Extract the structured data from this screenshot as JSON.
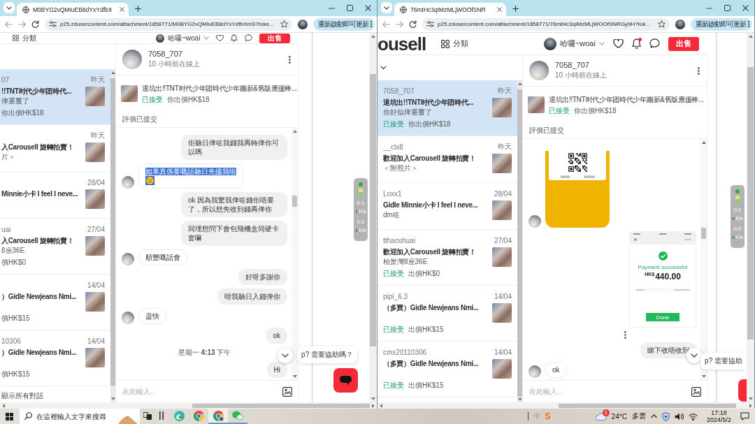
{
  "windows": [
    {
      "scrolled": true,
      "tab": {
        "title": "M0BYG2vQMIuEB8dYxYdfbX"
      },
      "toolbar": {
        "url": "p25.zdusercontent.com/attachment/1858771/M0BYG2vQMIuEB8dYxYdfbXmS?toke...",
        "update_label": "重新啟動即可更新"
      },
      "nav": {
        "categories": "分類",
        "greeting": "哈囉~woai",
        "sell": "出售",
        "bell_badge": false
      },
      "conversation_list": {
        "items": [
          {
            "name": "07",
            "date": "昨天",
            "title": "!!TNT时代少年团時代...",
            "preview": "俾重覆了",
            "offer": "你出價HK$18",
            "selected": true
          },
          {
            "date": "昨天",
            "title": "入Carousell 旋轉拍賣！",
            "preview": "片＞",
            "selected": false
          },
          {
            "date": "28/04",
            "title": "Minnie小卡 I feel I neve...",
            "selected": false
          },
          {
            "name": "uai",
            "date": "27/04",
            "title": "入Carousell 旋轉拍賣！",
            "preview": "8座36E",
            "offer": "價HK$0",
            "selected": false
          },
          {
            "date": "14/04",
            "title": "）Gidle Newjeans Nmi...",
            "offer": "價HK$15",
            "selected": false
          },
          {
            "name": "10306",
            "date": "14/04",
            "title": "）Gidle Newjeans Nmi...",
            "offer": "價HK$15",
            "selected": false
          }
        ],
        "footer": "顯示所有對話"
      },
      "chat": {
        "user": "7058_707",
        "status": "10 小時前在線上",
        "listing": {
          "title": "退坑出!!TNT时代少年团時代少年團新&舊版應援棒...",
          "state": "已接受",
          "offer": "你出價HK$18"
        },
        "notice": "評價已提交",
        "messages": [
          {
            "kind": "text",
            "outgoing": true,
            "text": "佢聽日俾咗我錢我再轉俾你可以嗎",
            "emoji": false,
            "highlighted": false
          },
          {
            "kind": "text",
            "outgoing": false,
            "text": "如果真係要嘅話聽日先搵我啦",
            "emoji": true,
            "highlighted": true
          },
          {
            "kind": "text",
            "outgoing": true,
            "text": "ok 因為我驚我俾咗錢佢唔要了，所以想先收到錢再俾你",
            "emoji": false,
            "highlighted": false
          },
          {
            "kind": "text",
            "outgoing": true,
            "text": "同埋想問下會包飛機盒同硬卡套嘛",
            "emoji": false,
            "highlighted": false
          },
          {
            "kind": "text",
            "outgoing": false,
            "text": "順豐嘅話會",
            "emoji": false,
            "highlighted": false
          },
          {
            "kind": "text",
            "outgoing": true,
            "text": "好呀多謝你",
            "emoji": false,
            "highlighted": false
          },
          {
            "kind": "text",
            "outgoing": true,
            "text": "咁我聽日入錢俾你",
            "emoji": false,
            "highlighted": false
          },
          {
            "kind": "text",
            "outgoing": false,
            "text": "盡快",
            "emoji": false,
            "highlighted": false
          },
          {
            "kind": "text",
            "outgoing": true,
            "text": "ok",
            "emoji": false,
            "highlighted": false
          },
          {
            "kind": "time",
            "text": "星期一 **4:13** 下午"
          },
          {
            "kind": "text",
            "outgoing": true,
            "text": "Hi",
            "emoji": false,
            "highlighted": false
          }
        ],
        "input_placeholder": "在此輸入..."
      },
      "help": {
        "prompt": "p? 需要協助嗎？",
        "clipped": false
      },
      "speed_widget": {
        "up": "0.1",
        "up_unit": "K/s",
        "down": "0.0",
        "down_unit": "K/s"
      }
    },
    {
      "scrolled": false,
      "tab": {
        "title": "76mtHc3qIMzMLjWOOfSNR"
      },
      "toolbar": {
        "url": "p25.zdusercontent.com/attachment/1858771/76mtHc3qIMzMLjWOOfSNRGy9H?tok...",
        "update_label": "重新啟動即可更新"
      },
      "nav": {
        "logo": "ousell",
        "categories": "分類",
        "greeting": "哈囉~woai",
        "sell": "出售",
        "bell_badge": true
      },
      "conversation_list": {
        "items": [
          {
            "name": "7058_707",
            "date": "昨天",
            "title": "退坑出!!TNT时代少年团時代...",
            "preview": "你好似俾重覆了",
            "state": "已接受",
            "offer": "你出價HK$18",
            "selected": true
          },
          {
            "name": "__clx8",
            "date": "昨天",
            "title": "歡迎加入Carousell 旋轉拍賣！",
            "preview": "＜附照片＞",
            "selected": false
          },
          {
            "name": "Loxx1",
            "date": "28/04",
            "title": "Gidle Minnie小卡 I feel I neve...",
            "preview": "dm咗",
            "selected": false
          },
          {
            "name": "tthaoshuai",
            "date": "27/04",
            "title": "歡迎加入Carousell 旋轉拍賣！",
            "preview": "柏景灣8座36E",
            "state": "已接受",
            "offer": "出價HK$0",
            "selected": false
          },
          {
            "name": "pipi_6.3",
            "date": "14/04",
            "title": "（多買）Gidle Newjeans Nmi...",
            "state": "已接受",
            "offer": "出價HK$15",
            "selected": false
          },
          {
            "name": "cmx20110306",
            "date": "14/04",
            "title": "（多買）Gidle Newjeans Nmi...",
            "state": "已接受",
            "offer": "出價HK$15",
            "selected": false
          }
        ]
      },
      "chat": {
        "user": "7058_707",
        "status": "10 小時前在線上",
        "listing": {
          "title": "退坑出!!TNT时代少年团時代少年團新&舊版應援棒...",
          "state": "已接受",
          "offer": "你出價HK$18"
        },
        "notice": "評價已提交",
        "messages": [
          {
            "kind": "qr_image",
            "outgoing": false
          },
          {
            "kind": "receipt_image",
            "outgoing": true,
            "status": "Payment successful",
            "currency": "HK$",
            "amount": "440.00",
            "button": "Done"
          },
          {
            "kind": "more"
          },
          {
            "kind": "text",
            "outgoing": true,
            "text": "睇下收唔收到",
            "emoji": false,
            "highlighted": false
          },
          {
            "kind": "text",
            "outgoing": false,
            "text": "ok",
            "emoji": false,
            "highlighted": false
          }
        ],
        "input_placeholder": "在此輸入..."
      },
      "help": {
        "prompt": "p? 需要協助",
        "clipped": true
      },
      "speed_widget": {
        "up": "0.0",
        "up_unit": "K/s",
        "down": "0.0",
        "down_unit": "K/s"
      }
    }
  ],
  "taskbar": {
    "search_placeholder": "在這裡輸入文字來搜尋",
    "apps": [
      {
        "kind": "task_view",
        "running": false,
        "selected": false
      },
      {
        "kind": "bars",
        "running": false,
        "selected": false
      },
      {
        "kind": "edge",
        "running": false,
        "selected": false
      },
      {
        "kind": "chrome",
        "running": false,
        "selected": false
      },
      {
        "kind": "chrome_profile",
        "running": true,
        "selected": true
      },
      {
        "kind": "wechat",
        "running": true,
        "selected": false
      }
    ],
    "input_method": {
      "label": "中",
      "logo": "S"
    },
    "weather": {
      "alert": "1",
      "temperature": "24°C",
      "condition": "多雲"
    },
    "time": "17:18",
    "date": "2024/5/2"
  }
}
